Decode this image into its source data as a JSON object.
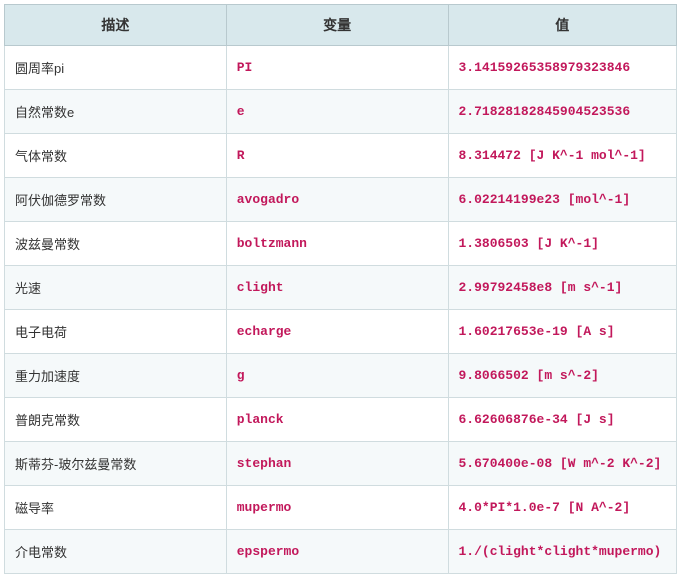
{
  "table": {
    "headers": {
      "description": "描述",
      "variable": "变量",
      "value": "值"
    },
    "rows": [
      {
        "description": "圆周率pi",
        "variable": "PI",
        "value": "3.14159265358979323846"
      },
      {
        "description": "自然常数e",
        "variable": "e",
        "value": "2.71828182845904523536"
      },
      {
        "description": "气体常数",
        "variable": "R",
        "value": "8.314472 [J K^-1 mol^-1]"
      },
      {
        "description": "阿伏伽德罗常数",
        "variable": "avogadro",
        "value": "6.02214199e23 [mol^-1]"
      },
      {
        "description": "波兹曼常数",
        "variable": "boltzmann",
        "value": "1.3806503 [J K^-1]"
      },
      {
        "description": "光速",
        "variable": "clight",
        "value": "2.99792458e8 [m s^-1]"
      },
      {
        "description": "电子电荷",
        "variable": "echarge",
        "value": "1.60217653e-19 [A s]"
      },
      {
        "description": "重力加速度",
        "variable": "g",
        "value": "9.8066502 [m s^-2]"
      },
      {
        "description": "普朗克常数",
        "variable": "planck",
        "value": "6.62606876e-34 [J s]"
      },
      {
        "description": "斯蒂芬-玻尔兹曼常数",
        "variable": "stephan",
        "value": "5.670400e-08 [W m^-2 K^-2]"
      },
      {
        "description": "磁导率",
        "variable": "mupermo",
        "value": "4.0*PI*1.0e-7 [N A^-2]"
      },
      {
        "description": "介电常数",
        "variable": "epspermo",
        "value": "1./(clight*clight*mupermo)"
      }
    ]
  }
}
